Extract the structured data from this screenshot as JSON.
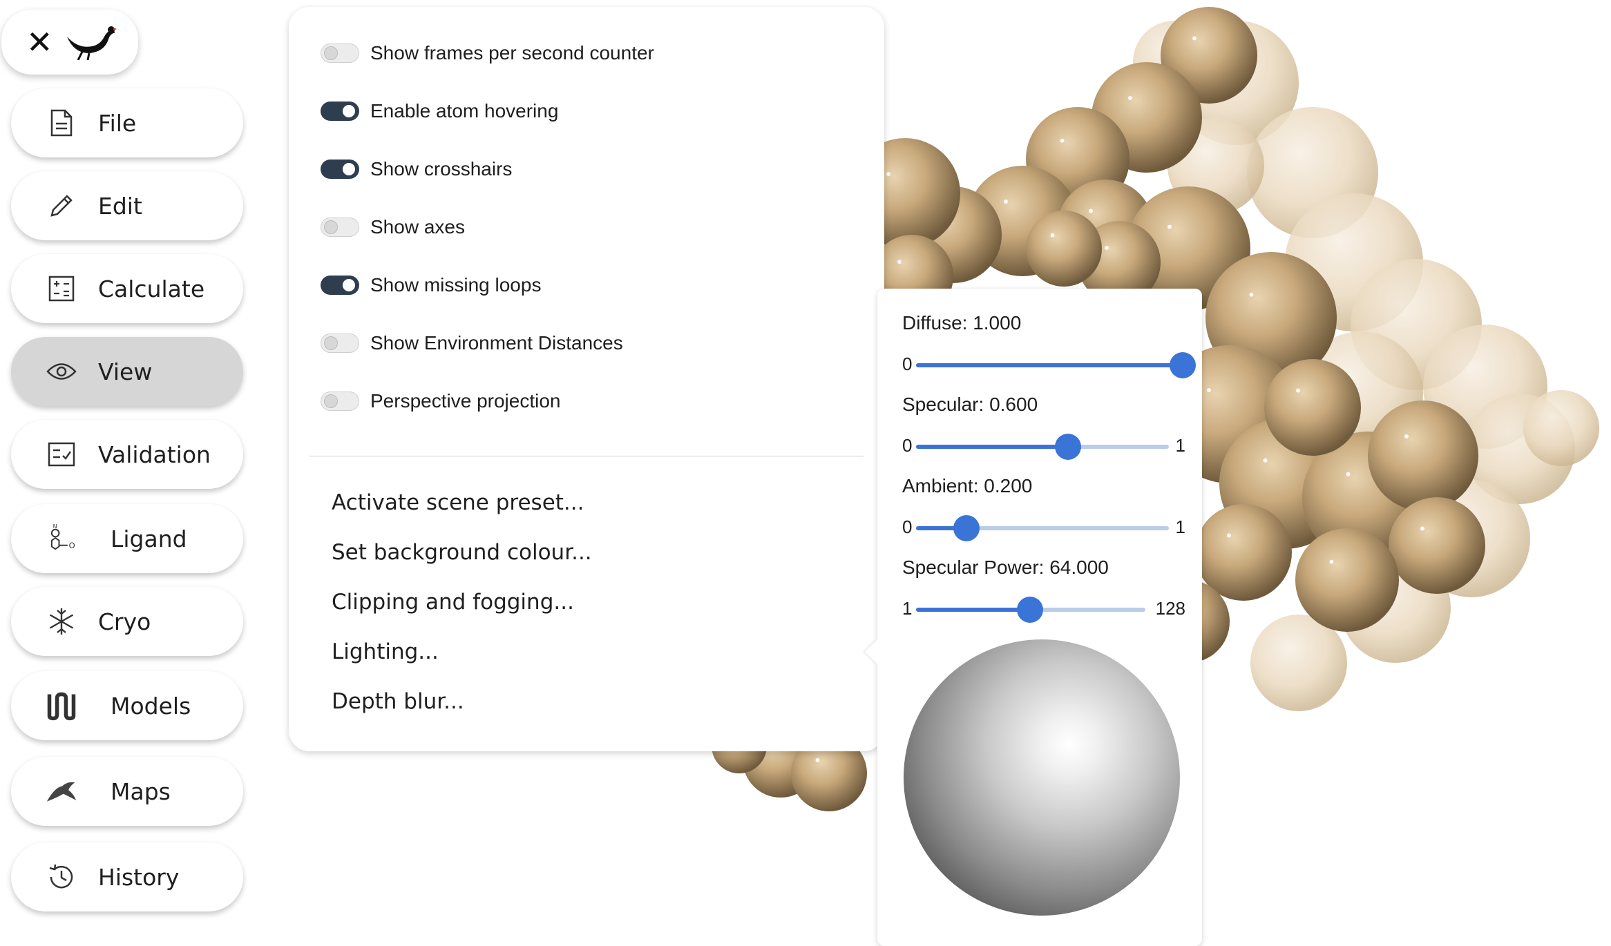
{
  "logo": {
    "close_glyph": "✕",
    "bird_icon": "coot-bird-logo"
  },
  "sidebar": {
    "items": [
      {
        "label": "File",
        "icon": "file-icon"
      },
      {
        "label": "Edit",
        "icon": "pencil-icon"
      },
      {
        "label": "Calculate",
        "icon": "calculator-icon"
      },
      {
        "label": "View",
        "icon": "eye-icon",
        "active": true
      },
      {
        "label": "Validation",
        "icon": "checklist-icon"
      },
      {
        "label": "Ligand",
        "icon": "molecule-icon"
      },
      {
        "label": "Cryo",
        "icon": "snowflake-icon"
      },
      {
        "label": "Models",
        "icon": "models-icon"
      },
      {
        "label": "Maps",
        "icon": "maps-icon"
      },
      {
        "label": "History",
        "icon": "history-icon"
      }
    ]
  },
  "view_menu": {
    "toggles": [
      {
        "label": "Show frames per second counter",
        "on": false
      },
      {
        "label": "Enable atom hovering",
        "on": true
      },
      {
        "label": "Show crosshairs",
        "on": true
      },
      {
        "label": "Show axes",
        "on": false
      },
      {
        "label": "Show missing loops",
        "on": true
      },
      {
        "label": "Show Environment Distances",
        "on": false
      },
      {
        "label": "Perspective projection",
        "on": false
      }
    ],
    "items": [
      "Activate scene preset...",
      "Set background colour...",
      "Clipping and fogging...",
      "Lighting...",
      "Depth blur..."
    ]
  },
  "lighting": {
    "sliders": [
      {
        "label": "Diffuse: 1.000",
        "min": "0",
        "max": "",
        "min_value": 0,
        "max_value": 1,
        "value": 1.0
      },
      {
        "label": "Specular: 0.600",
        "min": "0",
        "max": "1",
        "min_value": 0,
        "max_value": 1,
        "value": 0.6
      },
      {
        "label": "Ambient: 0.200",
        "min": "0",
        "max": "1",
        "min_value": 0,
        "max_value": 1,
        "value": 0.2
      },
      {
        "label": "Specular Power: 64.000",
        "min": "1",
        "max": "128",
        "min_value": 1,
        "max_value": 128,
        "value": 64
      }
    ]
  },
  "colors": {
    "toggle_on": "#2f3e4f",
    "slider_accent": "#3a74d6",
    "surface": "#c9ac80",
    "active_nav": "#d6d6d6"
  }
}
